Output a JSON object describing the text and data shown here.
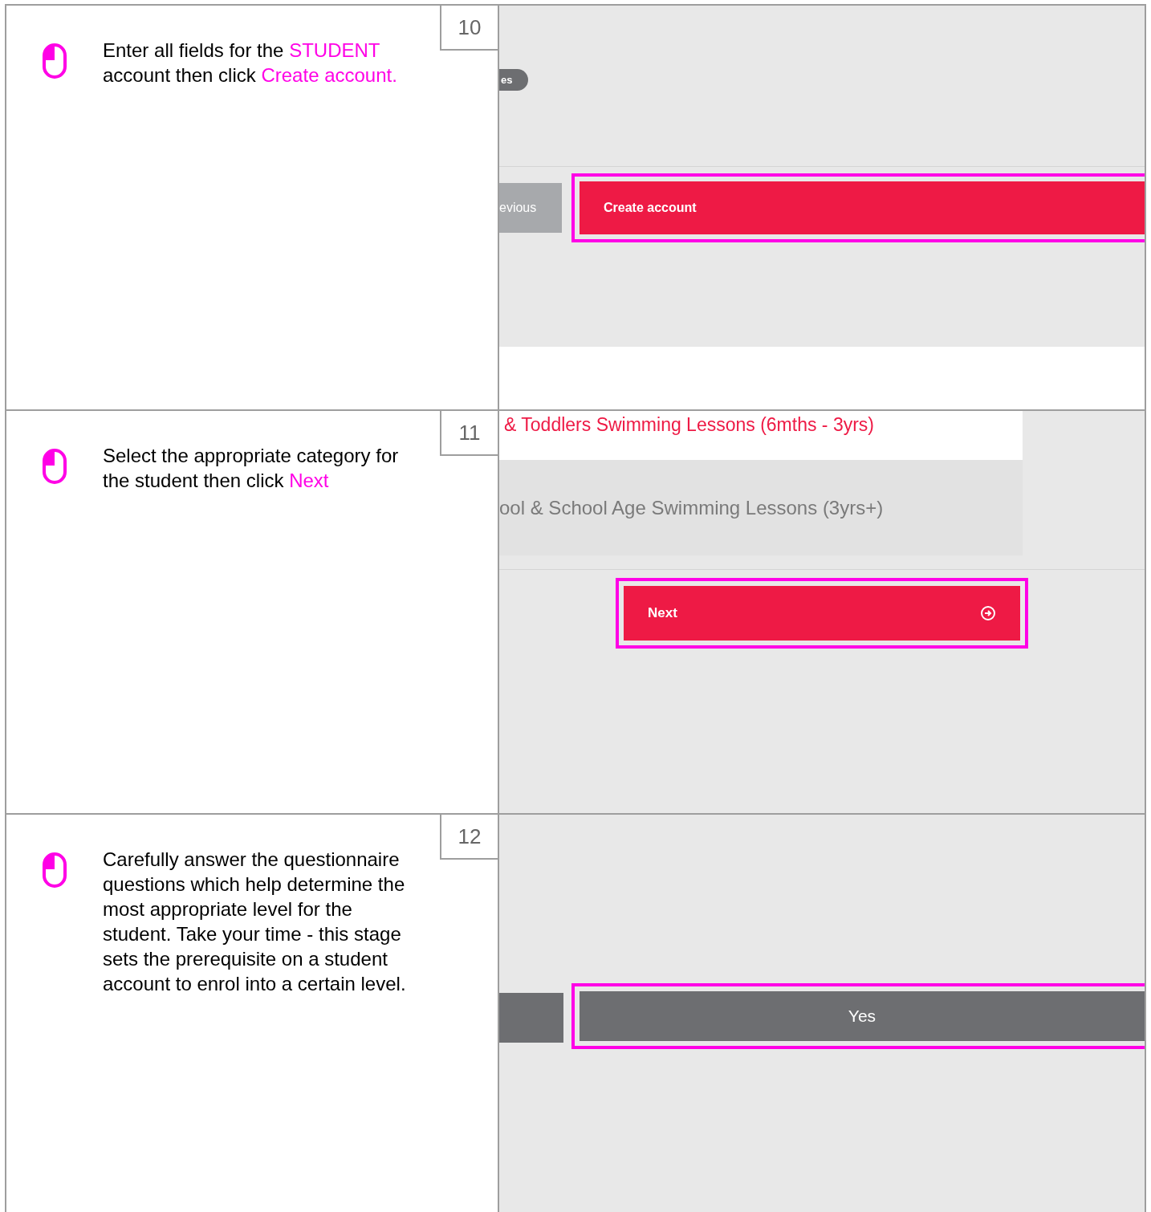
{
  "steps": [
    {
      "number": "10",
      "instruction": [
        {
          "text": "Enter all fields for the ",
          "highlight": false
        },
        {
          "text": "STUDENT",
          "highlight": true
        },
        {
          "text": " account then click ",
          "highlight": false
        },
        {
          "text": "Create account.",
          "highlight": true
        }
      ],
      "screen": {
        "kind": "account",
        "pill": "es",
        "back_button": "evious",
        "action": {
          "label": "Create account",
          "highlighted": true
        }
      }
    },
    {
      "number": "11",
      "instruction": [
        {
          "text": "Select the appropriate category for the student then click ",
          "highlight": false
        },
        {
          "text": "Next",
          "highlight": true
        }
      ],
      "screen": {
        "kind": "category",
        "options": [
          {
            "label": "& Toddlers Swimming Lessons (6mths - 3yrs)",
            "selected": true
          },
          {
            "label": "ool & School Age Swimming Lessons (3yrs+)",
            "selected": false
          }
        ],
        "action": {
          "label": "Next",
          "highlighted": true
        }
      }
    },
    {
      "number": "12",
      "instruction": [
        {
          "text": "Carefully answer the questionnaire questions which help determine the most appropriate level for the student. Take your time - this stage sets the prerequisite on a student account to enrol into a certain level.",
          "highlight": false
        }
      ],
      "screen": {
        "kind": "questionnaire",
        "action": {
          "label": "Yes",
          "highlighted": true
        }
      }
    }
  ]
}
